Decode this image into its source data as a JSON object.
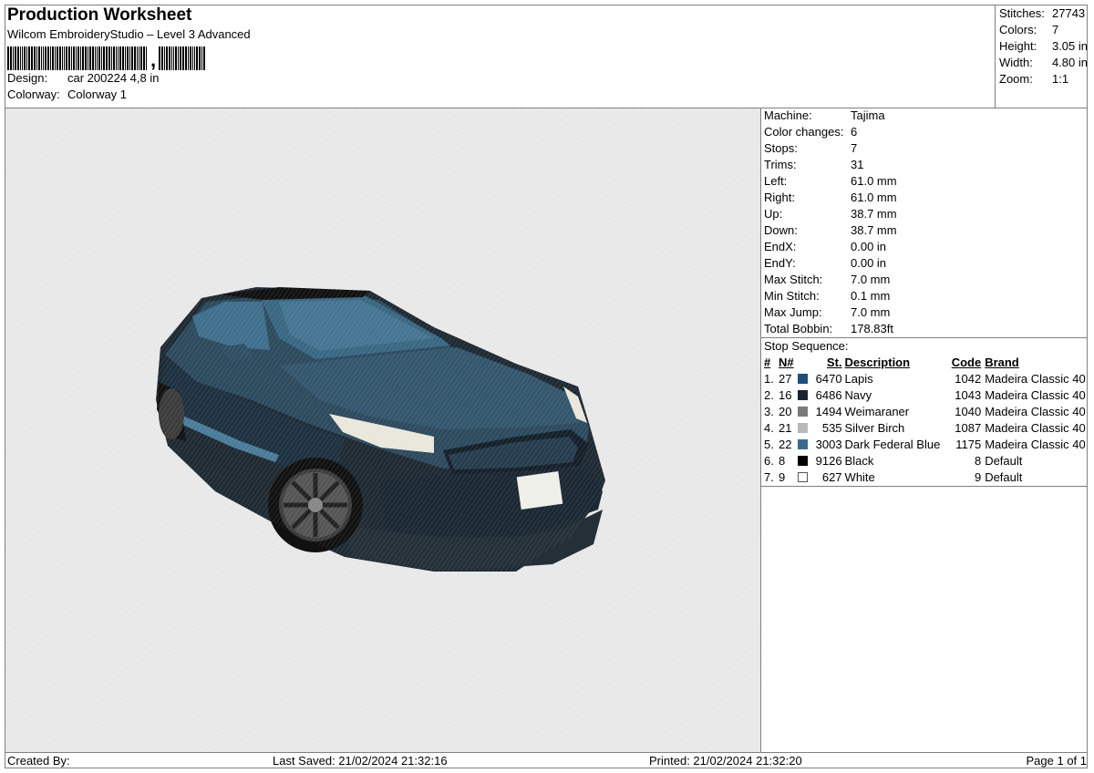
{
  "header": {
    "title": "Production Worksheet",
    "software": "Wilcom EmbroideryStudio – Level 3 Advanced",
    "design_label": "Design:",
    "design_value": "car 200224 4,8 in",
    "colorway_label": "Colorway:",
    "colorway_value": "Colorway 1"
  },
  "summary": [
    {
      "label": "Stitches:",
      "value": "27743"
    },
    {
      "label": "Colors:",
      "value": "7"
    },
    {
      "label": "Height:",
      "value": "3.05 in"
    },
    {
      "label": "Width:",
      "value": "4.80 in"
    },
    {
      "label": "Zoom:",
      "value": "1:1"
    }
  ],
  "machine_info": [
    {
      "label": "Machine:",
      "value": "Tajima"
    },
    {
      "label": "Color changes:",
      "value": "6"
    },
    {
      "label": "Stops:",
      "value": "7"
    },
    {
      "label": "Trims:",
      "value": "31"
    },
    {
      "label": "Left:",
      "value": "61.0 mm"
    },
    {
      "label": "Right:",
      "value": "61.0 mm"
    },
    {
      "label": "Up:",
      "value": "38.7 mm"
    },
    {
      "label": "Down:",
      "value": "38.7 mm"
    },
    {
      "label": "EndX:",
      "value": "0.00 in"
    },
    {
      "label": "EndY:",
      "value": "0.00 in"
    },
    {
      "label": "Max Stitch:",
      "value": "7.0 mm"
    },
    {
      "label": "Min Stitch:",
      "value": "0.1 mm"
    },
    {
      "label": "Max Jump:",
      "value": "7.0 mm"
    },
    {
      "label": "Total Bobbin:",
      "value": "178.83ft"
    }
  ],
  "stop_sequence": {
    "heading": "Stop Sequence:",
    "columns": [
      "#",
      "N#",
      "",
      "St.",
      "Description",
      "Code",
      "Brand"
    ],
    "rows": [
      {
        "num": "1.",
        "n": "27",
        "color": "#1f4e7c",
        "st": "6470",
        "desc": "Lapis",
        "code": "1042",
        "brand": "Madeira Classic 40"
      },
      {
        "num": "2.",
        "n": "16",
        "color": "#1c2330",
        "st": "6486",
        "desc": "Navy",
        "code": "1043",
        "brand": "Madeira Classic 40"
      },
      {
        "num": "3.",
        "n": "20",
        "color": "#7a7a7a",
        "st": "1494",
        "desc": "Weimaraner",
        "code": "1040",
        "brand": "Madeira Classic 40"
      },
      {
        "num": "4.",
        "n": "21",
        "color": "#b8b8b8",
        "st": "535",
        "desc": "Silver Birch",
        "code": "1087",
        "brand": "Madeira Classic 40"
      },
      {
        "num": "5.",
        "n": "22",
        "color": "#3d6a91",
        "st": "3003",
        "desc": "Dark Federal Blue",
        "code": "1175",
        "brand": "Madeira Classic 40"
      },
      {
        "num": "6.",
        "n": "8",
        "color": "#000000",
        "st": "9126",
        "desc": "Black",
        "code": "8",
        "brand": "Default"
      },
      {
        "num": "7.",
        "n": "9",
        "color": "#ffffff",
        "st": "627",
        "desc": "White",
        "code": "9",
        "brand": "Default"
      }
    ]
  },
  "footer": {
    "created_by": "Created By:",
    "last_saved": "Last Saved: 21/02/2024 21:32:16",
    "printed": "Printed: 21/02/2024 21:32:20",
    "page": "Page 1 of 1"
  }
}
